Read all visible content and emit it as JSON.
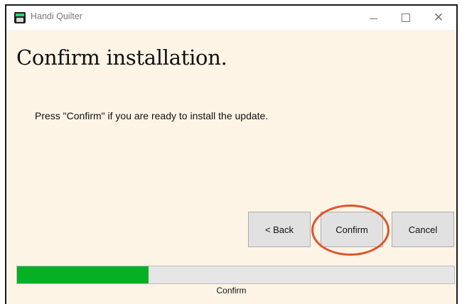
{
  "window": {
    "title": "Handi Quilter",
    "minimize_icon": "minimize-icon",
    "maximize_icon": "maximize-icon",
    "close_icon": "close-icon"
  },
  "content": {
    "heading": "Confirm installation.",
    "message": "Press \"Confirm\" if you are ready to install the update."
  },
  "buttons": {
    "back": "< Back",
    "confirm": "Confirm",
    "cancel": "Cancel"
  },
  "progress": {
    "fraction": 0.3,
    "label": "Confirm",
    "fill_color": "#06b025"
  },
  "colors": {
    "background": "#fdf4e6",
    "highlight": "#e0532a"
  }
}
